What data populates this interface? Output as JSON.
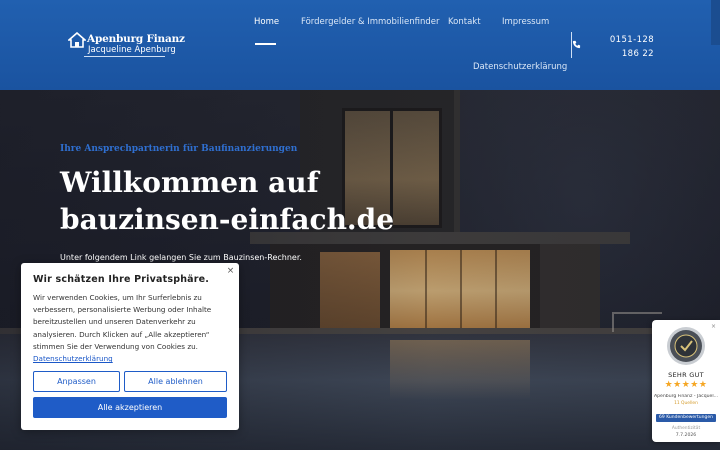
{
  "header": {
    "logo": {
      "line1": "Apenburg Finanz",
      "line2": "Jacqueline Apenburg"
    },
    "nav": {
      "home": "Home",
      "foerdergelder": "Fördergelder & Immobilienfinder",
      "kontakt": "Kontakt",
      "impressum": "Impressum",
      "datenschutz": "Datenschutzerklärung"
    },
    "phone": "0151-128 186 22",
    "active_nav": "Home"
  },
  "hero": {
    "kicker": "Ihre Ansprechpartnerin für Baufinanzierungen",
    "title": "Willkommen auf bauzinsen-einfach.de",
    "subtitle": "Unter folgendem Link gelangen Sie zum Bauzinsen-Rechner."
  },
  "cookie_banner": {
    "title": "Wir schätzen Ihre Privatsphäre.",
    "body": "Wir verwenden Cookies, um Ihr Surferlebnis zu verbessern, personalisierte Werbung oder Inhalte bereitzustellen und unseren Datenverkehr zu analysieren. Durch Klicken auf „Alle akzeptieren“ stimmen Sie der Verwendung von Cookies zu.",
    "link": "Datenschutzerklärung",
    "close": "×",
    "buttons": {
      "customize": "Anpassen",
      "reject_all": "Alle ablehnen",
      "accept_all": "Alle akzeptieren"
    }
  },
  "proven_expert": {
    "rating_label": "SEHR GUT",
    "stars": "★★★★★",
    "name": "Apenburg Finanz - Jacquel...",
    "sources": "11 Quellen",
    "reviews": "69 Kundenbewertungen",
    "authenticity": "Authentizität",
    "date": "7.7.2026",
    "close": "×"
  },
  "colors": {
    "header_blue": "#2160b0",
    "accent_blue": "#1f5cc7",
    "kicker_blue": "#2f6fd0",
    "star_gold": "#f5a623"
  }
}
